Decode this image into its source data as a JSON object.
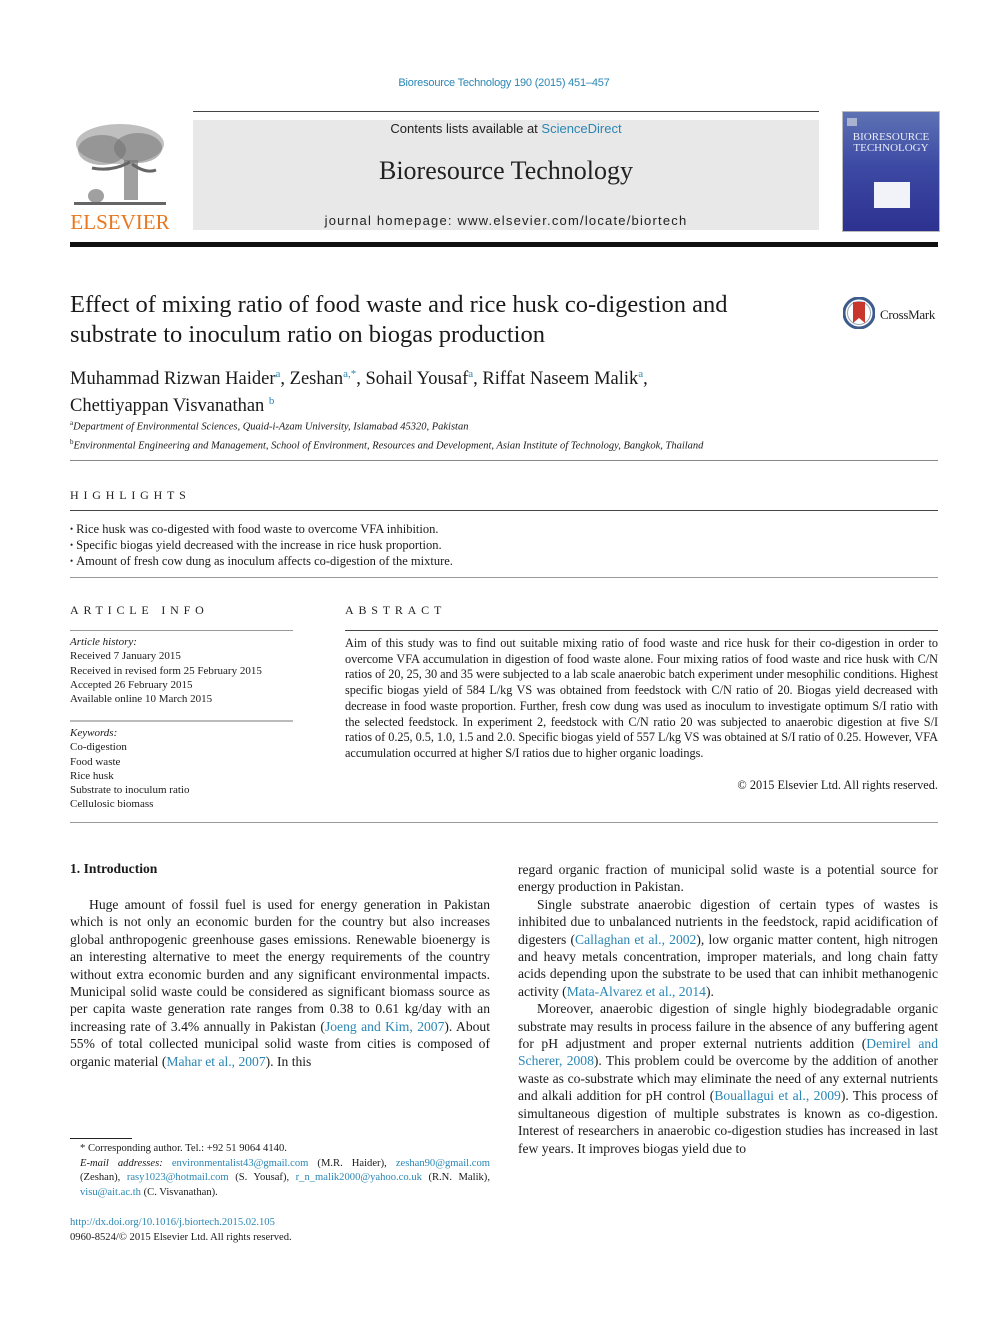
{
  "header": {
    "citation": "Bioresource Technology 190 (2015) 451–457",
    "contents_prefix": "Contents lists available at ",
    "contents_link": "ScienceDirect",
    "journal_title": "Bioresource Technology",
    "homepage": "journal homepage: www.elsevier.com/locate/biortech",
    "publisher": "ELSEVIER",
    "cover_title_line1": "BIORESOURCE",
    "cover_title_line2": "TECHNOLOGY",
    "crossmark_label": "CrossMark",
    "colors": {
      "link": "#2a86b4",
      "elsevier_orange": "#e8781f",
      "banner_grey": "#e8e8e8",
      "cover_blue": "#3d4aa4"
    }
  },
  "article": {
    "title": "Effect of mixing ratio of food waste and rice husk co-digestion and substrate to inoculum ratio on biogas production",
    "authors": [
      {
        "name": "Muhammad Rizwan Haider",
        "sup": "a",
        "sep": ", "
      },
      {
        "name": "Zeshan",
        "sup": "a,*",
        "sep": ", "
      },
      {
        "name": "Sohail Yousaf",
        "sup": "a",
        "sep": ", "
      },
      {
        "name": "Riffat Naseem Malik",
        "sup": "a",
        "sep": ","
      },
      {
        "name": "Chettiyappan Visvanathan",
        "sup": "b",
        "sep": ""
      }
    ],
    "affiliations": [
      {
        "sup": "a",
        "text": "Department of Environmental Sciences, Quaid-i-Azam University, Islamabad 45320, Pakistan"
      },
      {
        "sup": "b",
        "text": "Environmental Engineering and Management, School of Environment, Resources and Development, Asian Institute of Technology, Bangkok, Thailand"
      }
    ]
  },
  "highlights": {
    "heading": "HIGHLIGHTS",
    "bullet": "•",
    "items": [
      "Rice husk was co-digested with food waste to overcome VFA inhibition.",
      "Specific biogas yield decreased with the increase in rice husk proportion.",
      "Amount of fresh cow dung as inoculum affects co-digestion of the mixture."
    ]
  },
  "article_info": {
    "heading": "ARTICLE INFO",
    "history_label": "Article history:",
    "history": [
      "Received 7 January 2015",
      "Received in revised form 25 February 2015",
      "Accepted 26 February 2015",
      "Available online 10 March 2015"
    ],
    "keywords_label": "Keywords:",
    "keywords": [
      "Co-digestion",
      "Food waste",
      "Rice husk",
      "Substrate to inoculum ratio",
      "Cellulosic biomass"
    ]
  },
  "abstract": {
    "heading": "ABSTRACT",
    "text": "Aim of this study was to find out suitable mixing ratio of food waste and rice husk for their co-digestion in order to overcome VFA accumulation in digestion of food waste alone. Four mixing ratios of food waste and rice husk with C/N ratios of 20, 25, 30 and 35 were subjected to a lab scale anaerobic batch experiment under mesophilic conditions. Highest specific biogas yield of 584 L/kg VS was obtained from feedstock with C/N ratio of 20. Biogas yield decreased with decrease in food waste proportion. Further, fresh cow dung was used as inoculum to investigate optimum S/I ratio with the selected feedstock. In experiment 2, feedstock with C/N ratio 20 was subjected to anaerobic digestion at five S/I ratios of 0.25, 0.5, 1.0, 1.5 and 2.0. Specific biogas yield of 557 L/kg VS was obtained at S/I ratio of 0.25. However, VFA accumulation occurred at higher S/I ratios due to higher organic loadings.",
    "copyright": "© 2015 Elsevier Ltd. All rights reserved."
  },
  "body": {
    "section_heading": "1. Introduction",
    "left_paragraph": {
      "parts": [
        {
          "t": "Huge amount of fossil fuel is used for energy generation in Pakistan which is not only an economic burden for the country but also increases global anthropogenic greenhouse gases emissions. Renewable bioenergy is an interesting alternative to meet the energy requirements of the country without extra economic burden and any significant environmental impacts. Municipal solid waste could be considered as significant biomass source as per capita waste generation rate ranges from 0.38 to 0.61 kg/day with an increasing rate of 3.4% annually in Pakistan ("
        },
        {
          "link": "Joeng and Kim, 2007"
        },
        {
          "t": "). About 55% of total collected municipal solid waste from cities is composed of organic material ("
        },
        {
          "link": "Mahar et al., 2007"
        },
        {
          "t": "). In this"
        }
      ]
    },
    "right_paragraphs": [
      {
        "noindent": true,
        "parts": [
          {
            "t": "regard organic fraction of municipal solid waste is a potential source for energy production in Pakistan."
          }
        ]
      },
      {
        "parts": [
          {
            "t": "Single substrate anaerobic digestion of certain types of wastes is inhibited due to unbalanced nutrients in the feedstock, rapid acidification of digesters ("
          },
          {
            "link": "Callaghan et al., 2002"
          },
          {
            "t": "), low organic matter content, high nitrogen and heavy metals concentration, improper materials, and long chain fatty acids depending upon the substrate to be used that can inhibit methanogenic activity ("
          },
          {
            "link": "Mata-Alvarez et al., 2014"
          },
          {
            "t": ")."
          }
        ]
      },
      {
        "parts": [
          {
            "t": "Moreover, anaerobic digestion of single highly biodegradable organic substrate may results in process failure in the absence of any buffering agent for pH adjustment and proper external nutrients addition ("
          },
          {
            "link": "Demirel and Scherer, 2008"
          },
          {
            "t": "). This problem could be overcome by the addition of another waste as co-substrate which may eliminate the need of any external nutrients and alkali addition for pH control ("
          },
          {
            "link": "Bouallagui et al., 2009"
          },
          {
            "t": "). This process of simultaneous digestion of multiple substrates is known as co-digestion. Interest of researchers in anaerobic co-digestion studies has increased in last few years. It improves biogas yield due to"
          }
        ]
      }
    ]
  },
  "footnotes": {
    "corresponding": "* Corresponding author. Tel.: +92 51 9064 4140.",
    "email_label": "E-mail addresses:",
    "emails": [
      {
        "email": "environmentalist43@gmail.com",
        "who": " (M.R. Haider), "
      },
      {
        "email": "zeshan90@gmail.com",
        "who": " (Zeshan), "
      },
      {
        "email": "rasy1023@hotmail.com",
        "who": " (S. Yousaf), "
      },
      {
        "email": "r_n_malik2000@yahoo.co.uk",
        "who": " (R.N. Malik), "
      },
      {
        "email": "visu@ait.ac.th",
        "who": " (C. Visvanathan)."
      }
    ],
    "doi": "http://dx.doi.org/10.1016/j.biortech.2015.02.105",
    "issn_line": "0960-8524/© 2015 Elsevier Ltd. All rights reserved."
  }
}
